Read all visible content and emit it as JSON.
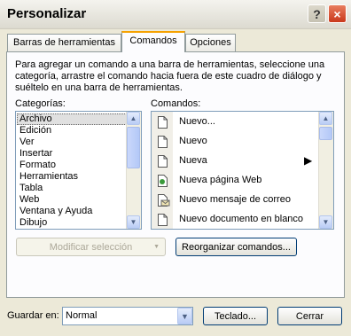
{
  "dialog": {
    "title": "Personalizar",
    "help_icon": "?",
    "close_icon": "×"
  },
  "tabs": [
    {
      "label": "Barras de herramientas",
      "active": false
    },
    {
      "label": "Comandos",
      "active": true
    },
    {
      "label": "Opciones",
      "active": false
    }
  ],
  "instructions": "Para agregar un comando a una barra de herramientas, seleccione una categoría, arrastre el comando hacia fuera de este cuadro de diálogo y suéltelo en una barra de herramientas.",
  "categories": {
    "label": "Categorías:",
    "items": [
      "Archivo",
      "Edición",
      "Ver",
      "Insertar",
      "Formato",
      "Herramientas",
      "Tabla",
      "Web",
      "Ventana y Ayuda",
      "Dibujo"
    ],
    "selected": "Archivo"
  },
  "commands": {
    "label": "Comandos:",
    "items": [
      {
        "label": "Nuevo...",
        "icon": "blank-document-icon"
      },
      {
        "label": "Nuevo",
        "icon": "blank-document-icon"
      },
      {
        "label": "Nueva",
        "icon": "blank-document-icon",
        "has_submenu": true
      },
      {
        "label": "Nueva página Web",
        "icon": "web-page-icon"
      },
      {
        "label": "Nuevo mensaje de correo",
        "icon": "email-message-icon"
      },
      {
        "label": "Nuevo documento en blanco",
        "icon": "blank-document-icon"
      }
    ]
  },
  "buttons": {
    "modify_selection": "Modificar selección",
    "rearrange_commands": "Reorganizar comandos...",
    "keyboard": "Teclado...",
    "close": "Cerrar"
  },
  "save_in": {
    "label": "Guardar en:",
    "value": "Normal"
  }
}
